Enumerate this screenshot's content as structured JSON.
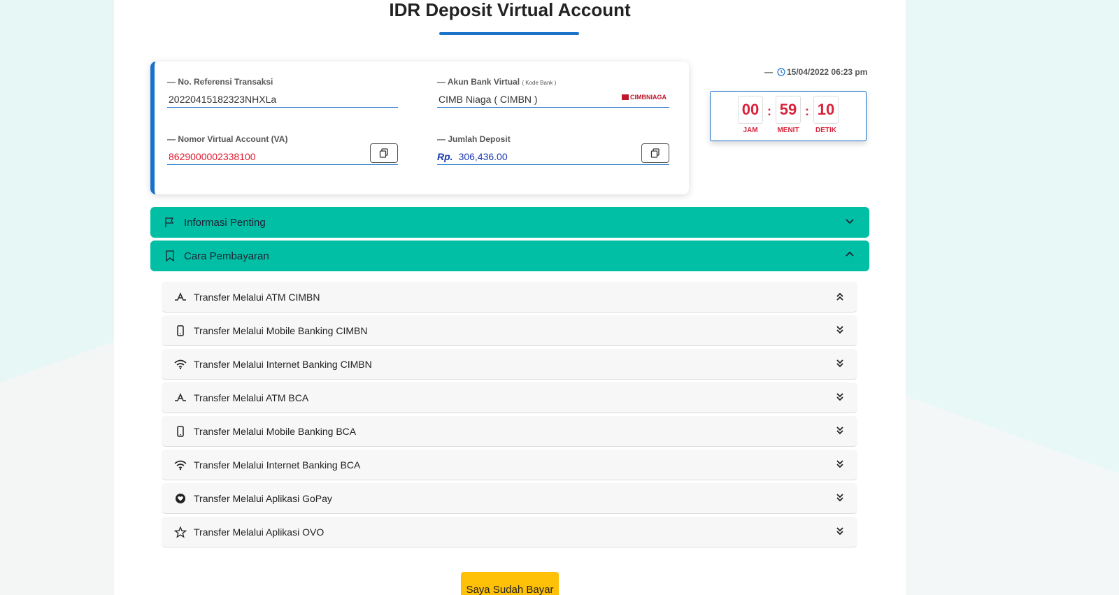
{
  "title": "IDR Deposit Virtual Account",
  "fields": {
    "reference": {
      "label": "— No. Referensi Transaksi",
      "value": "20220415182323NHXLa"
    },
    "bank": {
      "label": "— Akun Bank Virtual",
      "label_small": "( Kode Bank )",
      "value": "CIMB Niaga ( CIMBN )",
      "logo_text": "CIMBNIAGA"
    },
    "va": {
      "label": "— Nomor Virtual Account (VA)",
      "value": "8629000002338100"
    },
    "deposit": {
      "label": "— Jumlah Deposit",
      "currency": "Rp.",
      "value": "306,436.00"
    }
  },
  "datetime": "15/04/2022 06:23 pm",
  "datetime_prefix": "—",
  "timer": {
    "hours": "00",
    "minutes": "59",
    "seconds": "10",
    "hours_label": "JAM",
    "minutes_label": "MENIT",
    "seconds_label": "DETIK",
    "separator": ":"
  },
  "accordions": {
    "info": {
      "label": "Informasi Penting",
      "icon": "flag-icon"
    },
    "payment": {
      "label": "Cara Pembayaran",
      "icon": "bookmark-icon"
    }
  },
  "methods": [
    {
      "label": "Transfer Melalui ATM CIMBN",
      "icon": "atm-icon"
    },
    {
      "label": "Transfer Melalui Mobile Banking CIMBN",
      "icon": "phone-icon"
    },
    {
      "label": "Transfer Melalui Internet Banking CIMBN",
      "icon": "wifi-icon"
    },
    {
      "label": "Transfer Melalui ATM BCA",
      "icon": "atm-icon"
    },
    {
      "label": "Transfer Melalui Mobile Banking BCA",
      "icon": "phone-icon"
    },
    {
      "label": "Transfer Melalui Internet Banking BCA",
      "icon": "wifi-icon"
    },
    {
      "label": "Transfer Melalui Aplikasi GoPay",
      "icon": "heart-circle-icon"
    },
    {
      "label": "Transfer Melalui Aplikasi OVO",
      "icon": "star-icon"
    }
  ],
  "pay_button": "Saya Sudah Bayar",
  "colors": {
    "accent": "#1a73c9",
    "teal": "#00bfa5",
    "red": "#e0182d",
    "yellow": "#ffc107"
  }
}
